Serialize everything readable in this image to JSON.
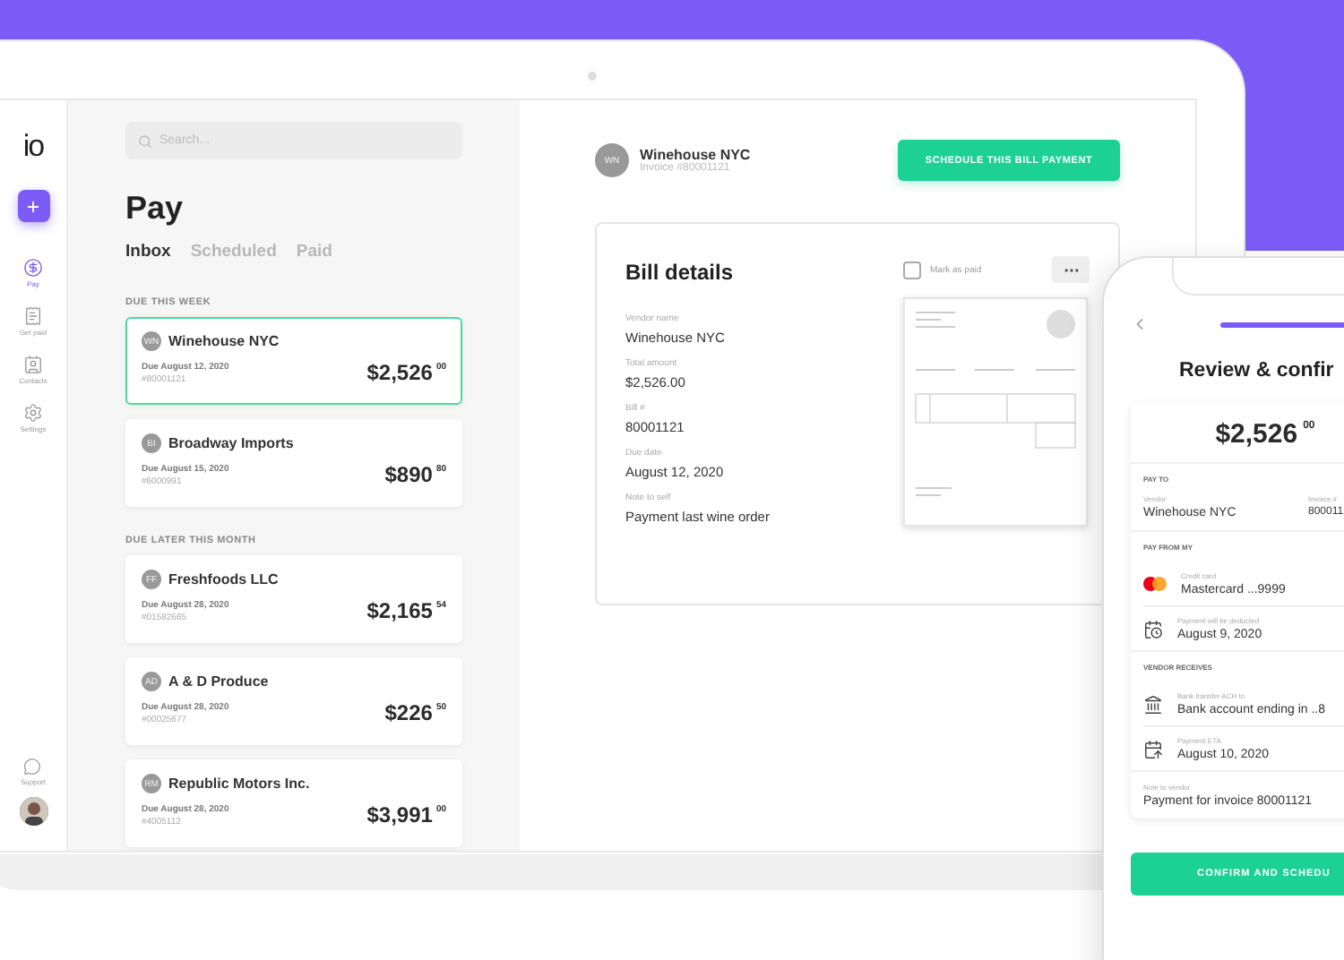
{
  "logo": "io",
  "sidebar": {
    "items": [
      {
        "label": "Pay",
        "selected": true
      },
      {
        "label": "Get paid",
        "selected": false
      },
      {
        "label": "Contacts",
        "selected": false
      },
      {
        "label": "Settings",
        "selected": false
      }
    ],
    "support": "Support"
  },
  "list": {
    "search_placeholder": "Search...",
    "title": "Pay",
    "tabs": [
      {
        "label": "Inbox",
        "selected": true
      },
      {
        "label": "Scheduled",
        "selected": false
      },
      {
        "label": "Paid",
        "selected": false
      }
    ],
    "groups": [
      {
        "heading": "DUE THIS WEEK",
        "bills": [
          {
            "initials": "WN",
            "vendor": "Winehouse NYC",
            "due": "Due August 12, 2020",
            "number": "#80001121",
            "amount": "$2,526",
            "cents": "00",
            "selected": true
          },
          {
            "initials": "BI",
            "vendor": "Broadway Imports",
            "due": "Due August 15, 2020",
            "number": "#6000991",
            "amount": "$890",
            "cents": "80",
            "selected": false
          }
        ]
      },
      {
        "heading": "DUE LATER THIS MONTH",
        "bills": [
          {
            "initials": "FF",
            "vendor": "Freshfoods LLC",
            "due": "Due August 28, 2020",
            "number": "#01582665",
            "amount": "$2,165",
            "cents": "54",
            "selected": false
          },
          {
            "initials": "AD",
            "vendor": "A & D Produce",
            "due": "Due August 28, 2020",
            "number": "#00025677",
            "amount": "$226",
            "cents": "50",
            "selected": false
          },
          {
            "initials": "RM",
            "vendor": "Republic Motors Inc.",
            "due": "Due August 28, 2020",
            "number": "#4005112",
            "amount": "$3,991",
            "cents": "00",
            "selected": false
          }
        ]
      }
    ]
  },
  "detail": {
    "initials": "WN",
    "vendor": "Winehouse NYC",
    "invoice": "Invoice #80001121",
    "action": "SCHEDULE THIS BILL PAYMENT",
    "card_title": "Bill details",
    "mark_paid": {
      "label": "Mark as paid",
      "checked": false
    },
    "fields": [
      {
        "label": "Vendor name",
        "value": "Winehouse NYC"
      },
      {
        "label": "Total amount",
        "value": "$2,526.00"
      },
      {
        "label": "Bill #",
        "value": "80001121"
      },
      {
        "label": "Due date",
        "value": "August 12, 2020"
      },
      {
        "label": "Note to self",
        "value": "Payment last wine order"
      }
    ]
  },
  "phone": {
    "title": "Review & confir",
    "progress": {
      "level": 1
    },
    "amount": "$2,526",
    "cents": "00",
    "pay_to": {
      "heading": "PAY TO",
      "vendor_label": "Vendor",
      "vendor": "Winehouse NYC",
      "invoice_label": "Invoice #",
      "invoice": "800011"
    },
    "sections": [
      {
        "heading": "PAY FROM MY",
        "rows": [
          {
            "label": "Credit card",
            "value": "Mastercard ...9999"
          },
          {
            "label": "Payment will be deducted",
            "value": "August 9, 2020"
          }
        ]
      },
      {
        "heading": "VENDOR RECEIVES",
        "rows": [
          {
            "label": "Bank transfer ACH to",
            "value": "Bank account ending in ..8"
          },
          {
            "label": "Payment ETA",
            "value": "August 10, 2020"
          }
        ]
      }
    ],
    "note": {
      "label": "Note to vendor",
      "value": "Payment for invoice 80001121"
    },
    "button": "CONFIRM AND SCHEDU"
  }
}
